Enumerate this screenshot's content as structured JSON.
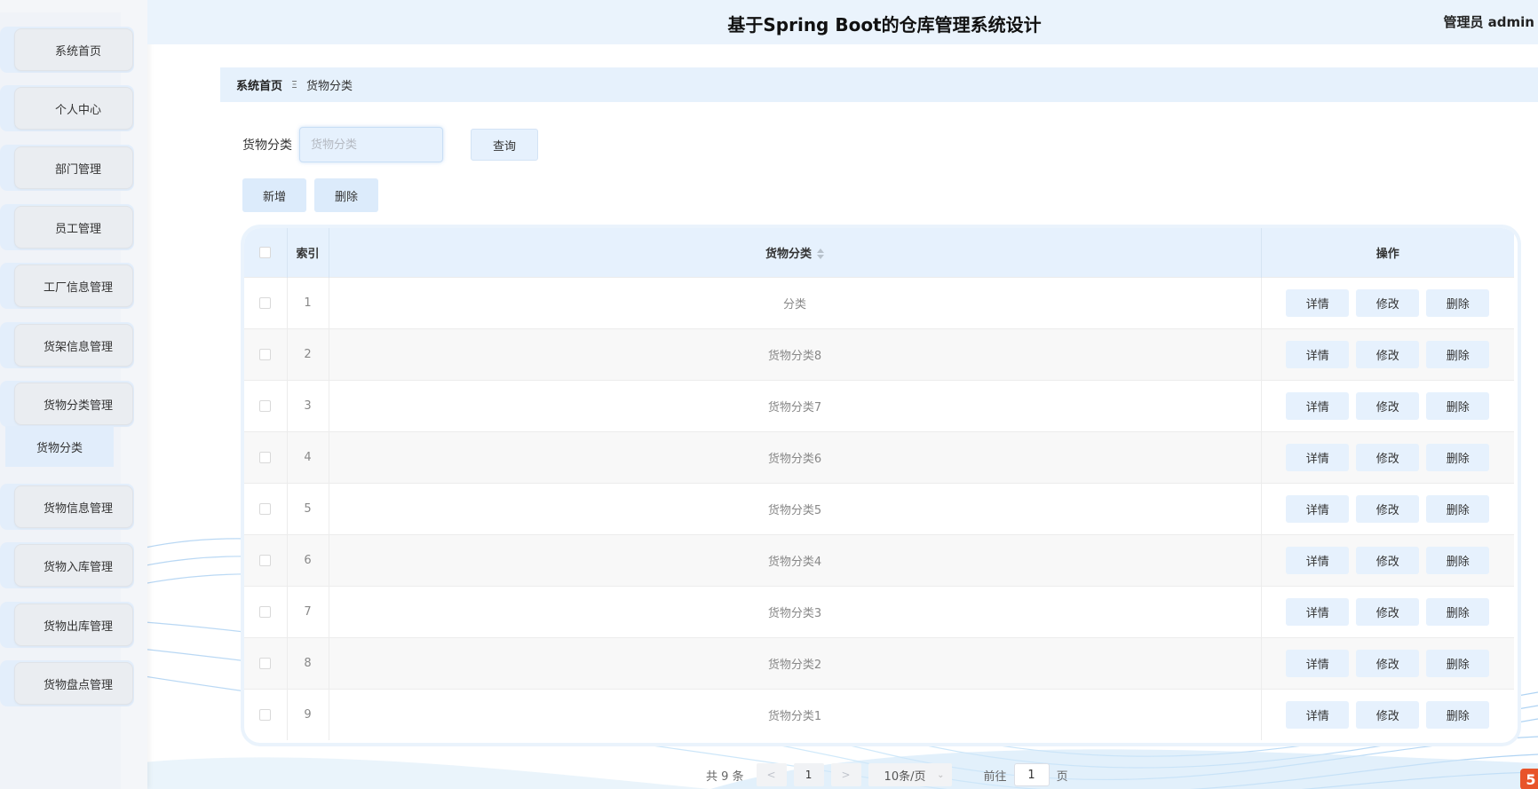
{
  "header": {
    "title": "基于Spring Boot的仓库管理系统设计",
    "user": "管理员 admin"
  },
  "sidebar": {
    "items": [
      {
        "label": "系统首页"
      },
      {
        "label": "个人中心"
      },
      {
        "label": "部门管理"
      },
      {
        "label": "员工管理"
      },
      {
        "label": "工厂信息管理"
      },
      {
        "label": "货架信息管理"
      },
      {
        "label": "货物分类管理"
      },
      {
        "label": "货物信息管理"
      },
      {
        "label": "货物入库管理"
      },
      {
        "label": "货物出库管理"
      },
      {
        "label": "货物盘点管理"
      }
    ],
    "submenu": {
      "label": "货物分类"
    }
  },
  "breadcrumb": {
    "home": "系统首页",
    "separator": "Ξ",
    "current": "货物分类"
  },
  "search": {
    "label": "货物分类",
    "placeholder": "货物分类",
    "query_label": "查询"
  },
  "actions": {
    "add_label": "新增",
    "delete_label": "删除"
  },
  "table": {
    "headers": {
      "index": "索引",
      "category": "货物分类",
      "operation": "操作"
    },
    "op_labels": {
      "detail": "详情",
      "edit": "修改",
      "delete": "删除"
    },
    "rows": [
      {
        "index": "1",
        "category": "分类"
      },
      {
        "index": "2",
        "category": "货物分类8"
      },
      {
        "index": "3",
        "category": "货物分类7"
      },
      {
        "index": "4",
        "category": "货物分类6"
      },
      {
        "index": "5",
        "category": "货物分类5"
      },
      {
        "index": "6",
        "category": "货物分类4"
      },
      {
        "index": "7",
        "category": "货物分类3"
      },
      {
        "index": "8",
        "category": "货物分类2"
      },
      {
        "index": "9",
        "category": "货物分类1"
      }
    ]
  },
  "pagination": {
    "total": "共 9 条",
    "prev": "<",
    "page": "1",
    "next": ">",
    "page_size": "10条/页",
    "goto_prefix": "前往",
    "goto_value": "1",
    "goto_suffix": "页"
  },
  "colors": {
    "accent": "#e6f1fd",
    "header_bg": "#eaf3fc",
    "sidebar_bg": "#f4f6f9"
  },
  "icons": {
    "corner": "html5-icon"
  }
}
